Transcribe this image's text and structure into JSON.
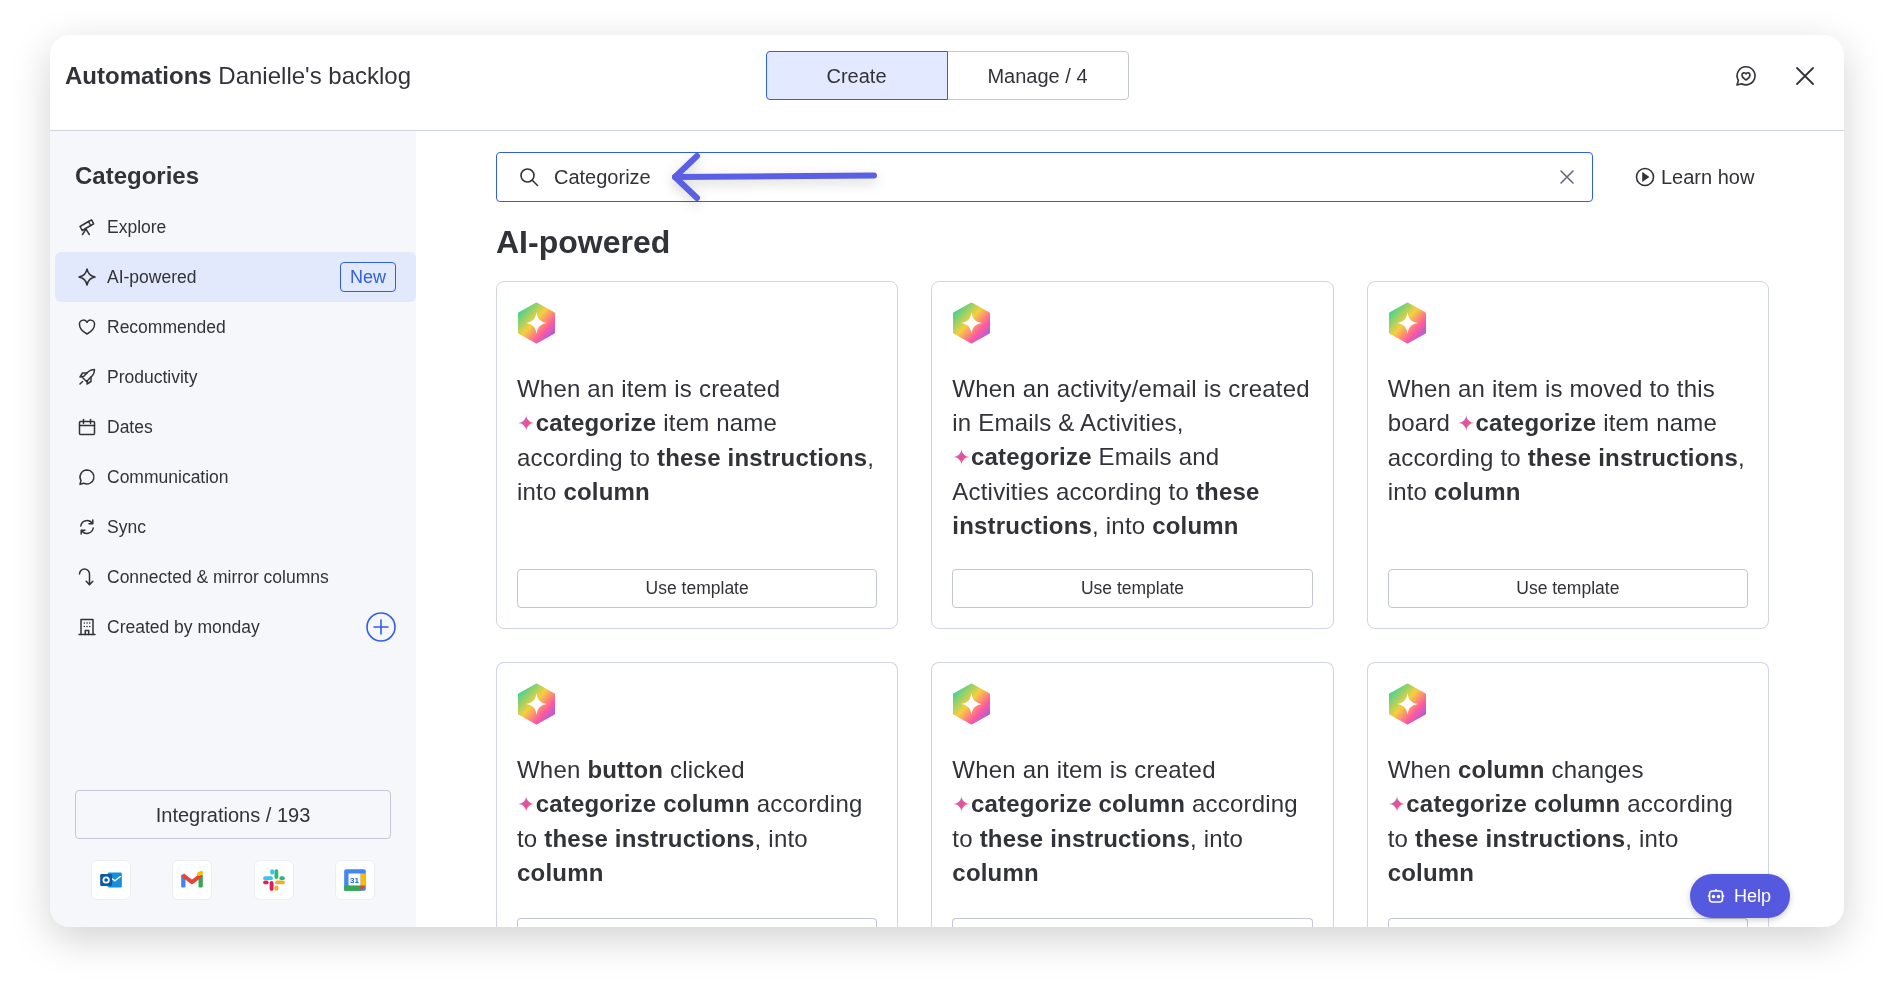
{
  "window": {
    "title": "**Automations** Danielle's backlog"
  },
  "tabs": [
    {
      "label": "Create",
      "selected": true
    },
    {
      "label": "Manage / 4",
      "selected": false
    }
  ],
  "sidebar": {
    "title": "Categories",
    "items": [
      {
        "label": "Explore",
        "selected": false,
        "addable": false
      },
      {
        "label": "AI-powered",
        "selected": true,
        "badge": "New",
        "addable": false
      },
      {
        "label": "Recommended",
        "selected": false,
        "addable": false
      },
      {
        "label": "Productivity",
        "selected": false,
        "addable": false
      },
      {
        "label": "Dates",
        "selected": false,
        "addable": false
      },
      {
        "label": "Communication",
        "selected": false,
        "addable": false
      },
      {
        "label": "Sync",
        "selected": false,
        "addable": false
      },
      {
        "label": "Connected & mirror columns",
        "selected": false,
        "addable": false
      },
      {
        "label": "Created by monday",
        "selected": false,
        "addable": true
      }
    ],
    "integrations_button": "Integrations / 193",
    "integrations": [
      {
        "kind": "envelope"
      },
      {
        "kind": "m-mark"
      },
      {
        "kind": "pinwheel"
      },
      {
        "kind": "calendar",
        "label": "31"
      }
    ]
  },
  "search": {
    "value": "Categorize"
  },
  "learn_how": "Learn how",
  "section_title": "AI-powered",
  "cards": [
    {
      "trigger": "When an item is created",
      "sparkle": "✦",
      "action": "**categorize** item name according to **these instructions**, into **column**",
      "button": "Use template"
    },
    {
      "trigger": "When an activity/email is created in Emails & Activities,",
      "sparkle": "✦",
      "action": "**categorize** Emails and Activities according to **these instructions**, into **column**",
      "button": "Use template"
    },
    {
      "trigger": "When an item is moved to this board",
      "sparkle": "✦",
      "action": "**categorize** item name according to **these instructions**, into **column**",
      "button": "Use template"
    },
    {
      "trigger": "When **button** clicked",
      "sparkle": "✦",
      "action": "**categorize column** according to **these instructions**, into **column**"
    },
    {
      "trigger": "When an item is created",
      "sparkle": "✦",
      "action": "**categorize column** according to **these instructions**, into **column**"
    },
    {
      "trigger": "When **column** changes",
      "sparkle": "✦",
      "action": "**categorize column** according to **these instructions**, into **column**"
    }
  ],
  "help_button": "Help"
}
